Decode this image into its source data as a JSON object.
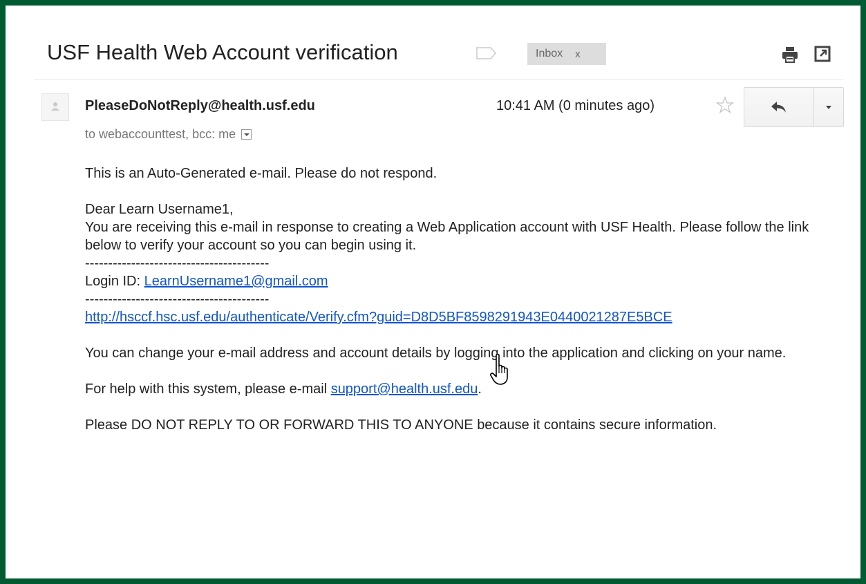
{
  "email": {
    "subject": "USF Health Web Account verification",
    "label_chip": "Inbox",
    "label_chip_close": "x",
    "sender": "PleaseDoNotReply@health.usf.edu",
    "recipients": "to webaccounttest, bcc: me",
    "timestamp": "10:41 AM (0 minutes ago)"
  },
  "body": {
    "line_auto": "This is an Auto-Generated e-mail.  Please do not respond.",
    "greeting": "Dear Learn Username1,",
    "paragraph_intro": "You are receiving this e-mail in response to creating a Web Application account with USF Health.  Please follow the link below to verify your account so you can begin using it.",
    "separator": "----------------------------------------",
    "login_label": "Login ID: ",
    "login_email": "LearnUsername1@gmail.com",
    "verify_link": "http://hsccf.hsc.usf.edu/authenticate/Verify.cfm?guid=D8D5BF8598291943E0440021287E5BCE",
    "change_text": "You can change your e-mail address and account details by logging into the application and clicking on your name.",
    "help_prefix": "For help with this system, please e-mail ",
    "support_email": "support@health.usf.edu",
    "help_suffix": ".",
    "warning_text": "Please DO NOT REPLY TO OR FORWARD THIS TO ANYONE because it contains secure information."
  },
  "icons": {
    "label": "label-icon",
    "print": "print-icon",
    "popout": "popout-icon",
    "avatar": "person-icon",
    "star": "star-icon",
    "reply": "reply-icon",
    "more": "chevron-down-icon",
    "cursor": "hand-pointer-icon"
  },
  "colors": {
    "frame": "#005a32",
    "link": "#1155cc",
    "text": "#222222",
    "muted": "#777777",
    "chip_bg": "#dddddd"
  }
}
